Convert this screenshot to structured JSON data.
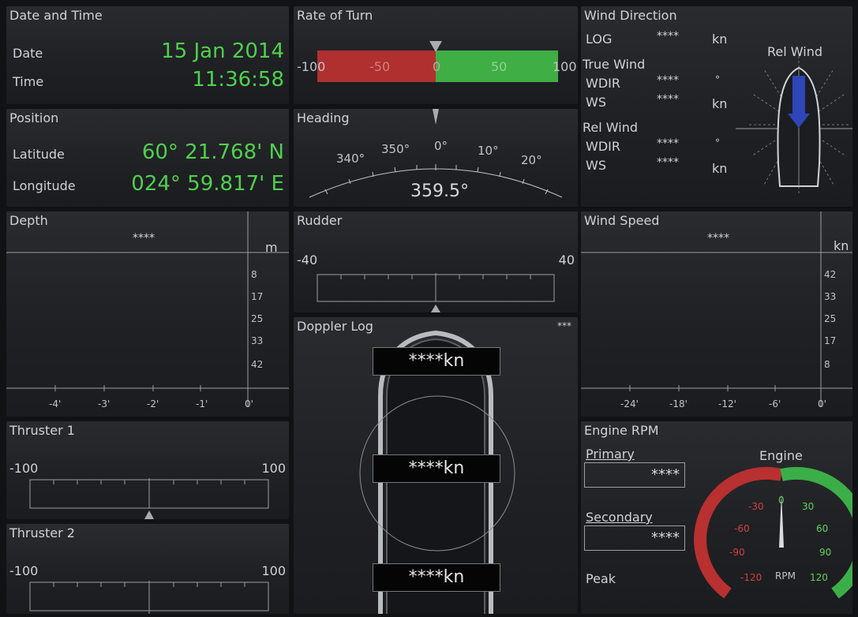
{
  "date_time": {
    "title": "Date and Time",
    "date_label": "Date",
    "date_value": "15 Jan 2014",
    "time_label": "Time",
    "time_value": "11:36:58"
  },
  "position": {
    "title": "Position",
    "lat_label": "Latitude",
    "lat_value": "60° 21.768' N",
    "lon_label": "Longitude",
    "lon_value": "024° 59.817' E"
  },
  "rate_of_turn": {
    "title": "Rate of Turn",
    "scale": [
      "-100",
      "-50",
      "0",
      "50",
      "100"
    ],
    "value": 0,
    "colors": {
      "negative": "#b03030",
      "positive": "#3fae45"
    }
  },
  "heading": {
    "title": "Heading",
    "scale": [
      "340°",
      "350°",
      "0°",
      "10°",
      "20°"
    ],
    "value": "359.5°"
  },
  "wind_direction": {
    "title": "Wind Direction",
    "log_label": "LOG",
    "log_value": "****",
    "log_unit": "kn",
    "true_wind": "True Wind",
    "tw_wdir_label": "WDIR",
    "tw_wdir_value": "****",
    "tw_wdir_unit": "°",
    "tw_ws_label": "WS",
    "tw_ws_value": "****",
    "tw_ws_unit": "kn",
    "rel_wind": "Rel Wind",
    "rw_wdir_label": "WDIR",
    "rw_wdir_value": "****",
    "rw_wdir_unit": "°",
    "rw_ws_label": "WS",
    "rw_ws_value": "****",
    "rw_ws_unit": "kn",
    "graphic_label": "Rel Wind"
  },
  "depth": {
    "title": "Depth",
    "value": "****",
    "unit": "m",
    "y_ticks": [
      "8",
      "17",
      "25",
      "33",
      "42"
    ],
    "x_ticks": [
      "-4'",
      "-3'",
      "-2'",
      "-1'",
      "0'"
    ]
  },
  "rudder": {
    "title": "Rudder",
    "left": "-40",
    "right": "40"
  },
  "wind_speed": {
    "title": "Wind Speed",
    "value": "****",
    "unit": "kn",
    "y_ticks": [
      "42",
      "33",
      "25",
      "17",
      "8"
    ],
    "x_ticks": [
      "-24'",
      "-18'",
      "-12'",
      "-6'",
      "0'"
    ]
  },
  "doppler_log": {
    "title": "Doppler Log",
    "status": "***",
    "fore": "****kn",
    "mid": "****kn",
    "aft": "****kn"
  },
  "thruster1": {
    "title": "Thruster 1",
    "left": "-100",
    "right": "100"
  },
  "thruster2": {
    "title": "Thruster 2",
    "left": "-100",
    "right": "100"
  },
  "engine_rpm": {
    "title": "Engine RPM",
    "primary_label": "Primary",
    "primary_value": "****",
    "secondary_label": "Secondary",
    "secondary_value": "****",
    "peak_label": "Peak",
    "gauge_title": "Engine",
    "gauge_unit": "RPM",
    "gauge_ticks": [
      "-120",
      "-90",
      "-60",
      "-30",
      "0",
      "30",
      "60",
      "90",
      "120"
    ],
    "rpm_value": 0,
    "colors": {
      "astern": "#b83030",
      "ahead": "#3cae48"
    }
  }
}
